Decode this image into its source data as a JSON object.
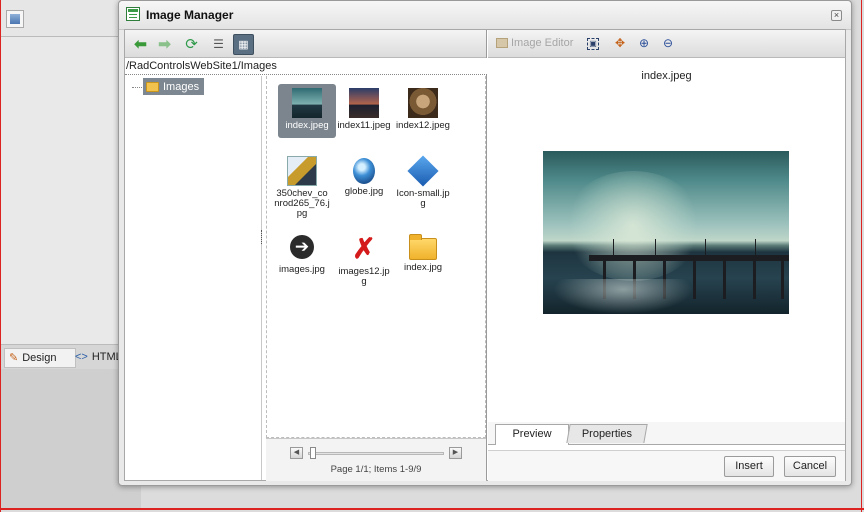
{
  "editor": {
    "mode_tabs": [
      {
        "label": "Design"
      },
      {
        "label": "HTML"
      }
    ]
  },
  "dialog": {
    "title": "Image Manager",
    "close_glyph": "×"
  },
  "browser": {
    "path": "/RadControlsWebSite1/Images",
    "tree": {
      "root_label": "Images"
    },
    "files": [
      {
        "name": "index.jpeg",
        "icon": "pier-thumbnail",
        "selected": true
      },
      {
        "name": "index11.jpeg",
        "icon": "sunset-thumbnail"
      },
      {
        "name": "index12.jpeg",
        "icon": "tiger-thumbnail"
      },
      {
        "name": "350chev_conrod265_76.jpg",
        "icon": "guitar-thumbnail"
      },
      {
        "name": "globe.jpg",
        "icon": "globe-icon"
      },
      {
        "name": "Icon-small.jpg",
        "icon": "diamond-arrow-icon"
      },
      {
        "name": "images.jpg",
        "icon": "arrow-right-circle-icon"
      },
      {
        "name": "images12.jpg",
        "icon": "red-x-icon"
      },
      {
        "name": "index.jpg",
        "icon": "folder-icon"
      }
    ],
    "pager": "Page 1/1; Items 1-9/9"
  },
  "preview": {
    "toolbar": {
      "image_editor_label": "Image Editor"
    },
    "file_name": "index.jpeg",
    "tabs": {
      "preview": "Preview",
      "properties": "Properties"
    },
    "buttons": {
      "insert": "Insert",
      "cancel": "Cancel"
    }
  },
  "colors": {
    "selection": "#7c858d",
    "accent_green": "#3a9a3a",
    "border_red": "#dd2222"
  }
}
